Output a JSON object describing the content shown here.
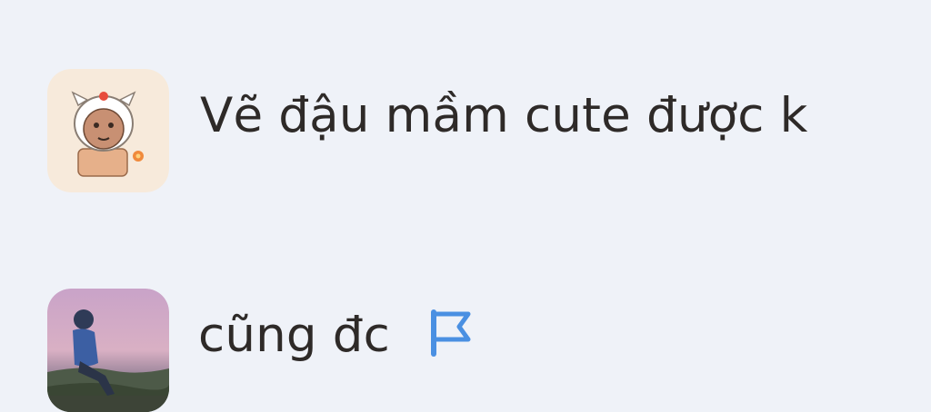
{
  "messages": [
    {
      "text": "Vẽ đậu mầm cute được k",
      "avatar_icon": "cartoon-character-avatar"
    },
    {
      "text": "cũng đc",
      "avatar_icon": "person-photo-avatar",
      "flag_icon": "flag-icon"
    }
  ],
  "colors": {
    "background": "#eff2f8",
    "text": "#2e2a28",
    "flag": "#4a90e2"
  }
}
